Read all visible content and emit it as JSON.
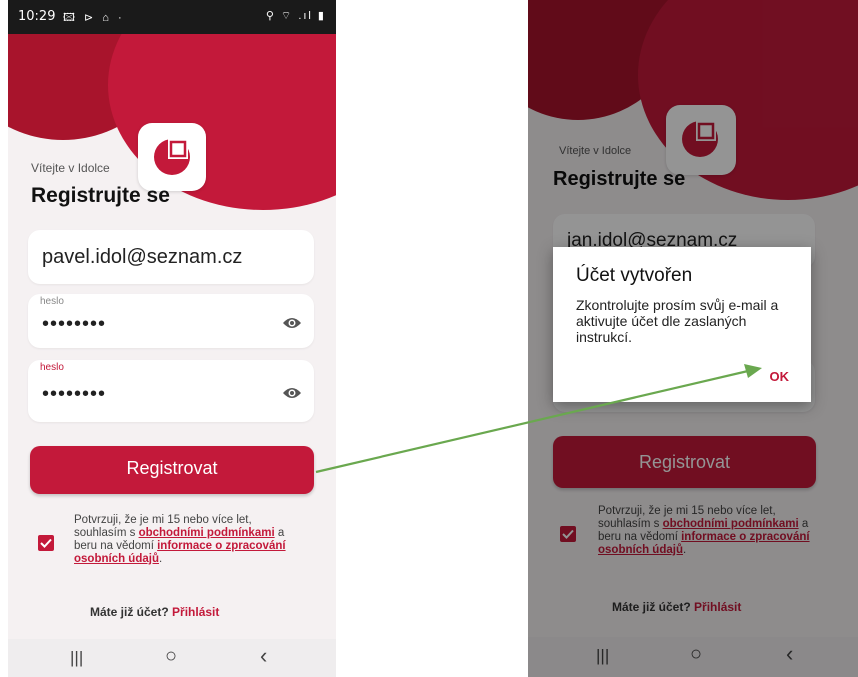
{
  "status_bar": {
    "time": "10:29",
    "left_icons": "🖾 ⊳ ⌂ ·",
    "right_icons": "⚲ ⌔ .ıl ▮"
  },
  "left_screen": {
    "welcome": "Vítejte v Idolce",
    "title": "Registrujte se",
    "email_value": "pavel.idol@seznam.cz",
    "password_label": "heslo",
    "password_mask": "••••••••",
    "password2_label": "heslo",
    "password2_mask": "••••••••",
    "register_button": "Registrovat",
    "consent_text_1": "Potvrzuji, že je mi 15 nebo více let, souhlasím s ",
    "consent_link_1": "obchodními podmínkami",
    "consent_text_2": " a beru na vědomí ",
    "consent_link_2": "informace o zpracování osobních údajů",
    "consent_text_3": ".",
    "already_text": "Máte již účet? ",
    "login_link": "Přihlásit"
  },
  "right_screen": {
    "welcome": "Vítejte v Idolce",
    "title": "Registrujte se",
    "email_value": "jan.idol@seznam.cz",
    "register_button": "Registrovat",
    "consent_text_1": "Potvrzuji, že je mi 15 nebo více let, souhlasím s ",
    "consent_link_1": "obchodními podmínkami",
    "consent_text_2": " a beru na vědomí ",
    "consent_link_2": "informace o zpracování osobních údajů",
    "consent_text_3": ".",
    "already_text": "Máte již účet? ",
    "login_link": "Přihlásit",
    "dialog": {
      "title": "Účet vytvořen",
      "body": "Zkontrolujte prosím svůj e-mail a aktivujte účet dle zaslaných instrukcí.",
      "ok_button": "OK"
    }
  },
  "nav_bar": {
    "recents": "|||",
    "home": "○",
    "back": "‹"
  },
  "colors": {
    "brand": "#c3193a",
    "brand_dark": "#a8142c",
    "arrow": "#6aa84f"
  }
}
